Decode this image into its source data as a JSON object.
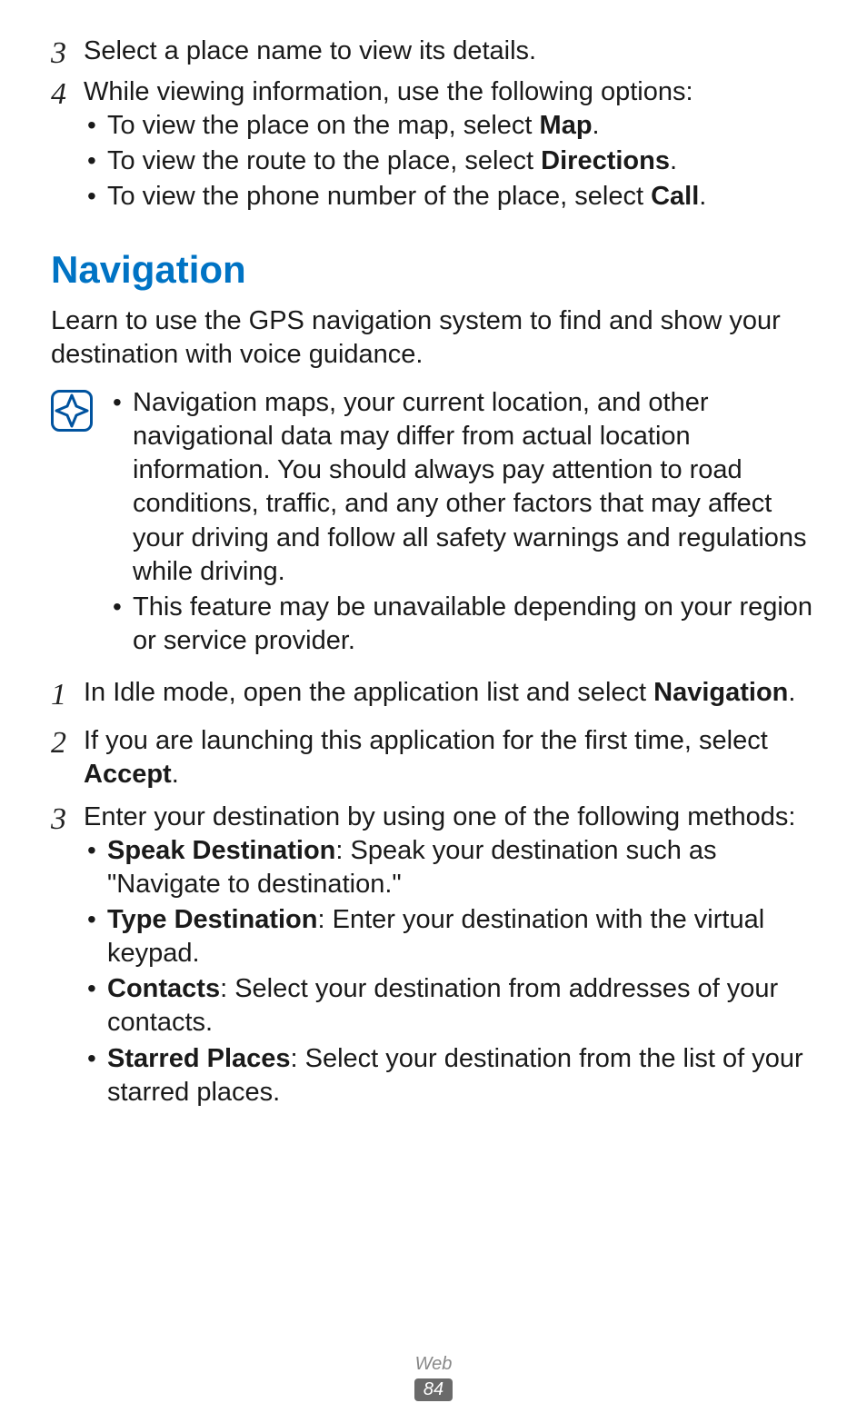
{
  "step3_top": {
    "num": "3",
    "text": "Select a place name to view its details."
  },
  "step4_top": {
    "num": "4",
    "lead": "While viewing information, use the following options:",
    "items": [
      {
        "pre": "To view the place on the map, select ",
        "bold": "Map",
        "post": "."
      },
      {
        "pre": "To view the route to the place, select ",
        "bold": "Directions",
        "post": "."
      },
      {
        "pre": "To view the phone number of the place, select ",
        "bold": "Call",
        "post": "."
      }
    ]
  },
  "section_title": "Navigation",
  "intro": "Learn to use the GPS navigation system to find and show your destination with voice guidance.",
  "note": {
    "items": [
      "Navigation maps, your current location, and other navigational data may differ from actual location information. You should always pay attention to road conditions, traffic, and any other factors that may affect your driving and follow all safety warnings and regulations while driving.",
      "This feature may be unavailable depending on your region or service provider."
    ]
  },
  "step1": {
    "num": "1",
    "pre": "In Idle mode, open the application list and select ",
    "bold": "Navigation",
    "post": "."
  },
  "step2": {
    "num": "2",
    "pre": "If you are launching this application for the first time, select ",
    "bold": "Accept",
    "post": "."
  },
  "step3": {
    "num": "3",
    "lead": "Enter your destination by using one of the following methods:",
    "items": [
      {
        "bold": "Speak Destination",
        "post": ": Speak your destination such as \"Navigate to destination.\""
      },
      {
        "bold": "Type Destination",
        "post": ": Enter your destination with the virtual keypad."
      },
      {
        "bold": "Contacts",
        "post": ": Select your destination from addresses of your contacts."
      },
      {
        "bold": "Starred Places",
        "post": ": Select your destination from the list of your starred places."
      }
    ]
  },
  "footer": {
    "label": "Web",
    "page": "84"
  }
}
